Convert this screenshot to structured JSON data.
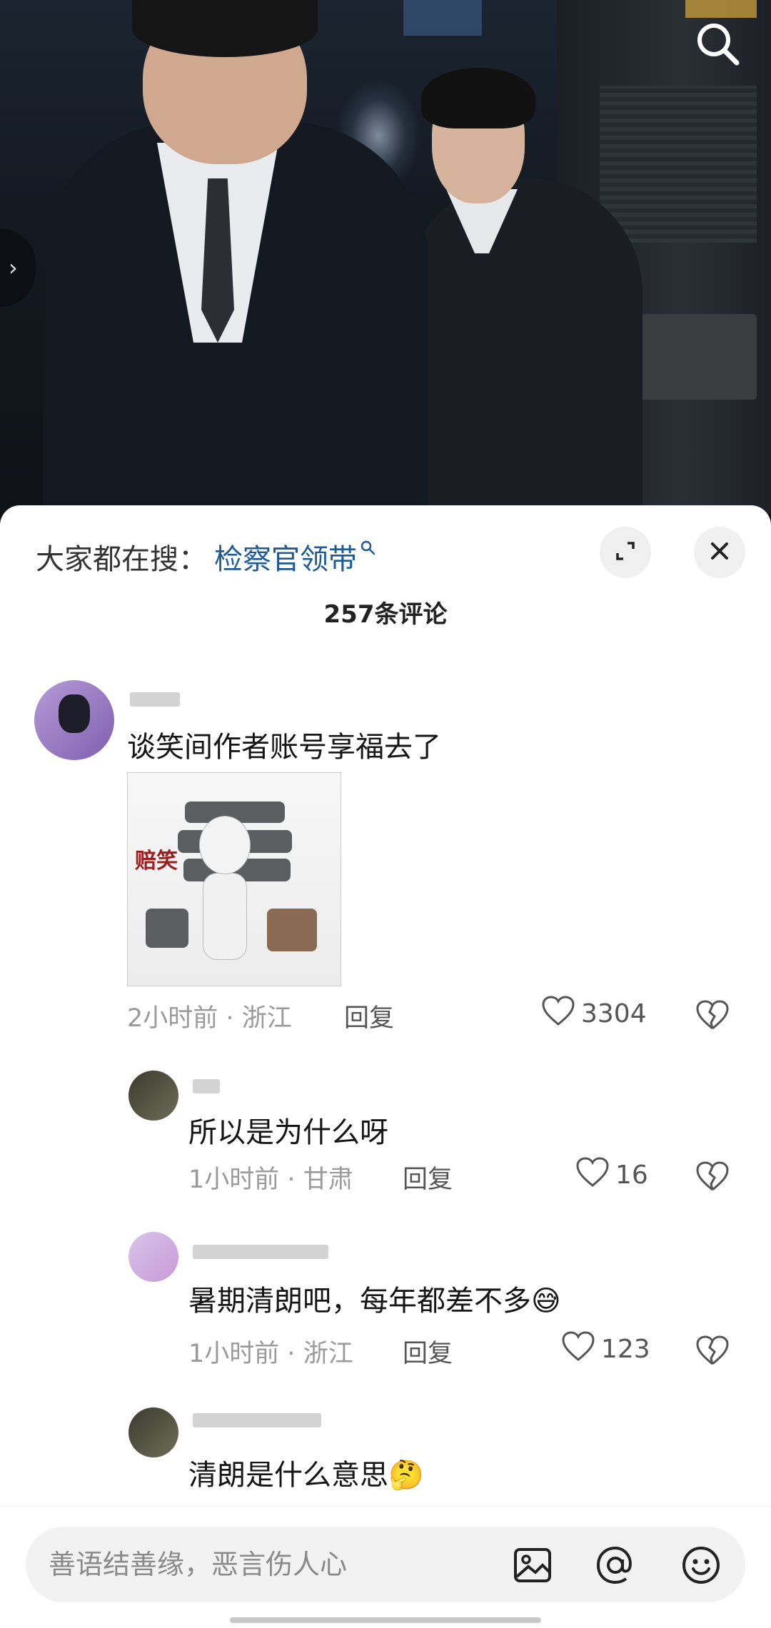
{
  "hot_search": {
    "prefix": "大家都在搜：",
    "keyword": "检察官领带"
  },
  "comments_count": "257条评论",
  "comments": [
    {
      "text": "谈笑间作者账号享福去了",
      "time": "2小时前",
      "location": "浙江",
      "reply": "回复",
      "likes": "3304",
      "meme_label": "赔笑"
    },
    {
      "text": "所以是为什么呀",
      "time": "1小时前",
      "location": "甘肃",
      "reply": "回复",
      "likes": "16"
    },
    {
      "text": "暑期清朗吧，每年都差不多😅",
      "time": "1小时前",
      "location": "浙江",
      "reply": "回复",
      "likes": "123"
    },
    {
      "text": "清朗是什么意思🤔"
    }
  ],
  "input": {
    "placeholder": "善语结善缘，恶言伤人心"
  },
  "icons": {
    "search": "search-icon",
    "expand": "expand-icon",
    "close": "close-icon",
    "heart": "heart-icon",
    "broken_heart": "broken-heart-icon",
    "image": "image-icon",
    "at": "at-icon",
    "emoji": "emoji-icon"
  },
  "colors": {
    "keyword": "#1e5b96",
    "meta": "#9a9a9a"
  }
}
